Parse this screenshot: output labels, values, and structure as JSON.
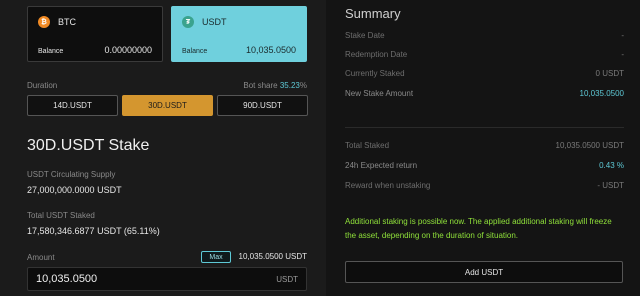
{
  "coins": {
    "btc": {
      "name": "BTC",
      "icon": "bitcoin-icon",
      "balance_label": "Balance",
      "balance": "0.00000000"
    },
    "usdt": {
      "name": "USDT",
      "icon": "tether-icon",
      "balance_label": "Balance",
      "balance": "10,035.0500"
    }
  },
  "duration": {
    "label": "Duration",
    "bot_share_label": "Bot share",
    "bot_share_value": "35.23",
    "bot_share_unit": "%",
    "options": [
      "14D.USDT",
      "30D.USDT",
      "90D.USDT"
    ],
    "selected": "30D.USDT"
  },
  "stake": {
    "title": "30D.USDT Stake",
    "supply_label": "USDT Circulating Supply",
    "supply_value": "27,000,000.0000 USDT",
    "staked_label": "Total USDT Staked",
    "staked_value": "17,580,346.6877 USDT (65.11%)",
    "amount_label": "Amount",
    "max_label": "Max",
    "max_value": "10,035.0500 USDT",
    "amount_value": "10,035.0500",
    "amount_unit": "USDT"
  },
  "summary": {
    "title": "Summary",
    "rows": [
      {
        "key": "Stake Date",
        "value": "-"
      },
      {
        "key": "Redemption Date",
        "value": "-"
      },
      {
        "key": "Currently Staked",
        "value": "0 USDT"
      },
      {
        "key": "New Stake Amount",
        "value": "10,035.0500"
      }
    ],
    "rows2": [
      {
        "key": "Total Staked",
        "value": "10,035.0500 USDT"
      },
      {
        "key": "24h Expected return",
        "value": "0.43 %"
      },
      {
        "key": "Reward when unstaking",
        "value": "- USDT"
      }
    ],
    "notice": "Additional staking is possible now. The applied additional staking will freeze the asset, depending on the duration of situation.",
    "add_button": "Add USDT"
  },
  "colors": {
    "accent": "#5ec9d6",
    "active_duration": "#d4962f",
    "notice": "#8fe03a"
  }
}
